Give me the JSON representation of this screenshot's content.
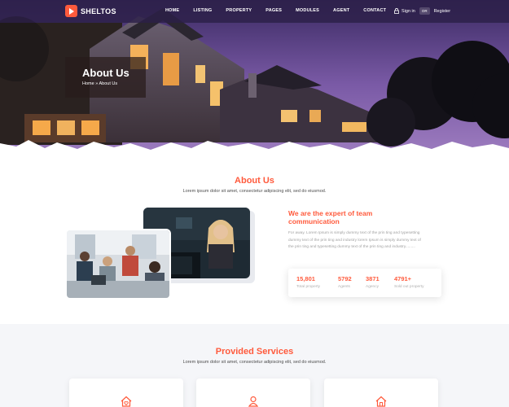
{
  "brand": {
    "name": "SHELTOS",
    "accent": "#ff5a3c"
  },
  "nav": [
    "HOME",
    "LISTING",
    "PROPERTY",
    "PAGES",
    "MODULES",
    "AGENT",
    "CONTACT"
  ],
  "auth": {
    "sign_in": "Sign in",
    "or": "OR",
    "register": "Register"
  },
  "hero": {
    "title": "About Us",
    "breadcrumb_home": "Home",
    "breadcrumb_sep": "»",
    "breadcrumb_current": "About Us"
  },
  "about": {
    "title": "About Us",
    "subtitle": "Lorem ipsum dolor sit amet, consectetur adipiscing elit, sed do eiusmod.",
    "heading_line1": "We are the expert of team",
    "heading_line2": "communication",
    "body": "For away. Lorem Ipsum is simply dummy text of the prin ting and typesetting dummy text of the prin ting and industry lorem Ipsum is simply dummy text of the prin ting and typesetting dummy text of the prin ting and industry.........",
    "stats": [
      {
        "value": "15,801",
        "label": "Total property"
      },
      {
        "value": "5792",
        "label": "Agents"
      },
      {
        "value": "3871",
        "label": "Agency"
      },
      {
        "value": "4791+",
        "label": "Sold out property"
      }
    ]
  },
  "services": {
    "title": "Provided Services",
    "subtitle": "Lorem ipsum dolor sit amet, consectetur adipiscing elit, sed do eiusmod.",
    "cards": [
      {
        "icon": "house-heart-icon"
      },
      {
        "icon": "agent-icon"
      },
      {
        "icon": "house-icon"
      }
    ]
  }
}
